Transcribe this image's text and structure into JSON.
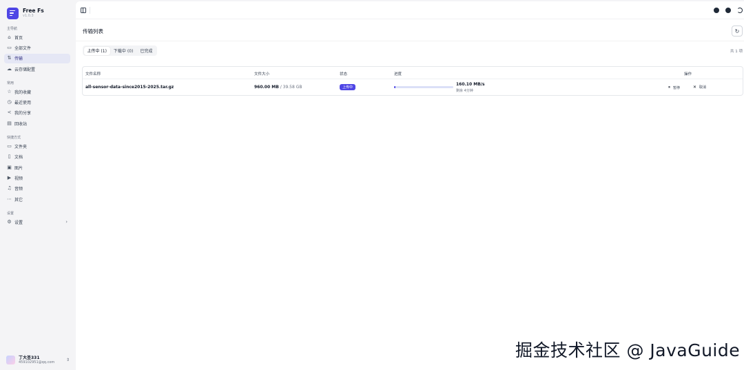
{
  "app": {
    "name": "Free Fs",
    "version": "v1.0.3"
  },
  "sidebar": {
    "groups": [
      {
        "label": "主导航",
        "items": [
          {
            "label": "首页",
            "icon": "home-icon"
          },
          {
            "label": "全部文件",
            "icon": "folder-open-icon"
          },
          {
            "label": "传输",
            "icon": "transfer-icon",
            "active": true
          },
          {
            "label": "云存储配置",
            "icon": "cloud-icon"
          }
        ]
      },
      {
        "label": "常用",
        "items": [
          {
            "label": "我的收藏",
            "icon": "star-icon"
          },
          {
            "label": "最近使用",
            "icon": "clock-icon"
          },
          {
            "label": "我的分享",
            "icon": "share-icon"
          },
          {
            "label": "回收站",
            "icon": "trash-icon"
          }
        ]
      },
      {
        "label": "快捷方式",
        "items": [
          {
            "label": "文件夹",
            "icon": "folder-icon"
          },
          {
            "label": "文档",
            "icon": "document-icon"
          },
          {
            "label": "图片",
            "icon": "image-icon"
          },
          {
            "label": "视频",
            "icon": "video-icon"
          },
          {
            "label": "音频",
            "icon": "music-icon"
          },
          {
            "label": "其它",
            "icon": "more-icon"
          }
        ]
      },
      {
        "label": "设置",
        "items": [
          {
            "label": "设置",
            "icon": "gear-icon"
          }
        ]
      }
    ]
  },
  "user": {
    "name": "丁大圣331",
    "email": "459102951@qq.com"
  },
  "page": {
    "title": "传输列表",
    "tabs": [
      {
        "label": "上传中 (1)",
        "active": true
      },
      {
        "label": "下载中 (0)",
        "active": false
      },
      {
        "label": "已完成",
        "active": false
      }
    ],
    "total": "共 1 项"
  },
  "table": {
    "headers": {
      "name": "文件名称",
      "size": "文件大小",
      "status": "状态",
      "progress": "进度",
      "actions": "操作"
    },
    "rows": [
      {
        "name": "all-sensor-data-since2015-2025.tar.gz",
        "size_current": "960.00 MB",
        "size_total": " / 39.58 GB",
        "status": "上传中",
        "progress": 0.024,
        "speed": "160.10 MB/s",
        "remaining": "剩余 4分钟",
        "pause_label": "暂停",
        "cancel_label": "取消"
      }
    ]
  },
  "colors": {
    "accent": "#4f46e5",
    "active_nav_bg": "#e5e7f5"
  },
  "watermark": "掘金技术社区 @ JavaGuide"
}
